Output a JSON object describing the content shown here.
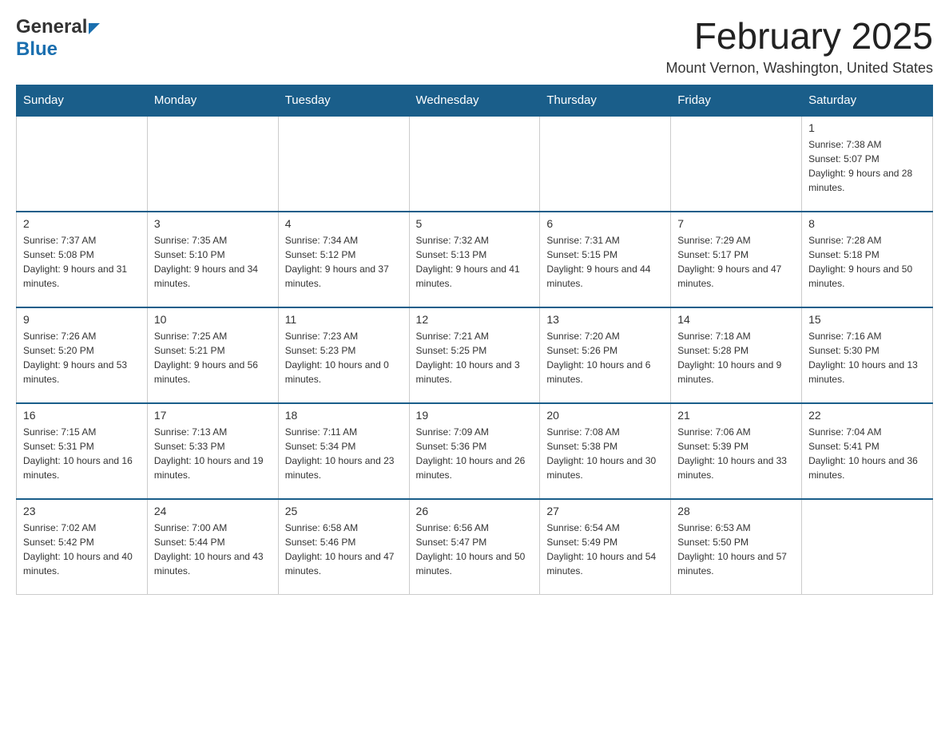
{
  "header": {
    "logo_general": "General",
    "logo_blue": "Blue",
    "month_title": "February 2025",
    "location": "Mount Vernon, Washington, United States"
  },
  "weekdays": [
    "Sunday",
    "Monday",
    "Tuesday",
    "Wednesday",
    "Thursday",
    "Friday",
    "Saturday"
  ],
  "weeks": [
    [
      {
        "day": "",
        "info": ""
      },
      {
        "day": "",
        "info": ""
      },
      {
        "day": "",
        "info": ""
      },
      {
        "day": "",
        "info": ""
      },
      {
        "day": "",
        "info": ""
      },
      {
        "day": "",
        "info": ""
      },
      {
        "day": "1",
        "info": "Sunrise: 7:38 AM\nSunset: 5:07 PM\nDaylight: 9 hours and 28 minutes."
      }
    ],
    [
      {
        "day": "2",
        "info": "Sunrise: 7:37 AM\nSunset: 5:08 PM\nDaylight: 9 hours and 31 minutes."
      },
      {
        "day": "3",
        "info": "Sunrise: 7:35 AM\nSunset: 5:10 PM\nDaylight: 9 hours and 34 minutes."
      },
      {
        "day": "4",
        "info": "Sunrise: 7:34 AM\nSunset: 5:12 PM\nDaylight: 9 hours and 37 minutes."
      },
      {
        "day": "5",
        "info": "Sunrise: 7:32 AM\nSunset: 5:13 PM\nDaylight: 9 hours and 41 minutes."
      },
      {
        "day": "6",
        "info": "Sunrise: 7:31 AM\nSunset: 5:15 PM\nDaylight: 9 hours and 44 minutes."
      },
      {
        "day": "7",
        "info": "Sunrise: 7:29 AM\nSunset: 5:17 PM\nDaylight: 9 hours and 47 minutes."
      },
      {
        "day": "8",
        "info": "Sunrise: 7:28 AM\nSunset: 5:18 PM\nDaylight: 9 hours and 50 minutes."
      }
    ],
    [
      {
        "day": "9",
        "info": "Sunrise: 7:26 AM\nSunset: 5:20 PM\nDaylight: 9 hours and 53 minutes."
      },
      {
        "day": "10",
        "info": "Sunrise: 7:25 AM\nSunset: 5:21 PM\nDaylight: 9 hours and 56 minutes."
      },
      {
        "day": "11",
        "info": "Sunrise: 7:23 AM\nSunset: 5:23 PM\nDaylight: 10 hours and 0 minutes."
      },
      {
        "day": "12",
        "info": "Sunrise: 7:21 AM\nSunset: 5:25 PM\nDaylight: 10 hours and 3 minutes."
      },
      {
        "day": "13",
        "info": "Sunrise: 7:20 AM\nSunset: 5:26 PM\nDaylight: 10 hours and 6 minutes."
      },
      {
        "day": "14",
        "info": "Sunrise: 7:18 AM\nSunset: 5:28 PM\nDaylight: 10 hours and 9 minutes."
      },
      {
        "day": "15",
        "info": "Sunrise: 7:16 AM\nSunset: 5:30 PM\nDaylight: 10 hours and 13 minutes."
      }
    ],
    [
      {
        "day": "16",
        "info": "Sunrise: 7:15 AM\nSunset: 5:31 PM\nDaylight: 10 hours and 16 minutes."
      },
      {
        "day": "17",
        "info": "Sunrise: 7:13 AM\nSunset: 5:33 PM\nDaylight: 10 hours and 19 minutes."
      },
      {
        "day": "18",
        "info": "Sunrise: 7:11 AM\nSunset: 5:34 PM\nDaylight: 10 hours and 23 minutes."
      },
      {
        "day": "19",
        "info": "Sunrise: 7:09 AM\nSunset: 5:36 PM\nDaylight: 10 hours and 26 minutes."
      },
      {
        "day": "20",
        "info": "Sunrise: 7:08 AM\nSunset: 5:38 PM\nDaylight: 10 hours and 30 minutes."
      },
      {
        "day": "21",
        "info": "Sunrise: 7:06 AM\nSunset: 5:39 PM\nDaylight: 10 hours and 33 minutes."
      },
      {
        "day": "22",
        "info": "Sunrise: 7:04 AM\nSunset: 5:41 PM\nDaylight: 10 hours and 36 minutes."
      }
    ],
    [
      {
        "day": "23",
        "info": "Sunrise: 7:02 AM\nSunset: 5:42 PM\nDaylight: 10 hours and 40 minutes."
      },
      {
        "day": "24",
        "info": "Sunrise: 7:00 AM\nSunset: 5:44 PM\nDaylight: 10 hours and 43 minutes."
      },
      {
        "day": "25",
        "info": "Sunrise: 6:58 AM\nSunset: 5:46 PM\nDaylight: 10 hours and 47 minutes."
      },
      {
        "day": "26",
        "info": "Sunrise: 6:56 AM\nSunset: 5:47 PM\nDaylight: 10 hours and 50 minutes."
      },
      {
        "day": "27",
        "info": "Sunrise: 6:54 AM\nSunset: 5:49 PM\nDaylight: 10 hours and 54 minutes."
      },
      {
        "day": "28",
        "info": "Sunrise: 6:53 AM\nSunset: 5:50 PM\nDaylight: 10 hours and 57 minutes."
      },
      {
        "day": "",
        "info": ""
      }
    ]
  ]
}
